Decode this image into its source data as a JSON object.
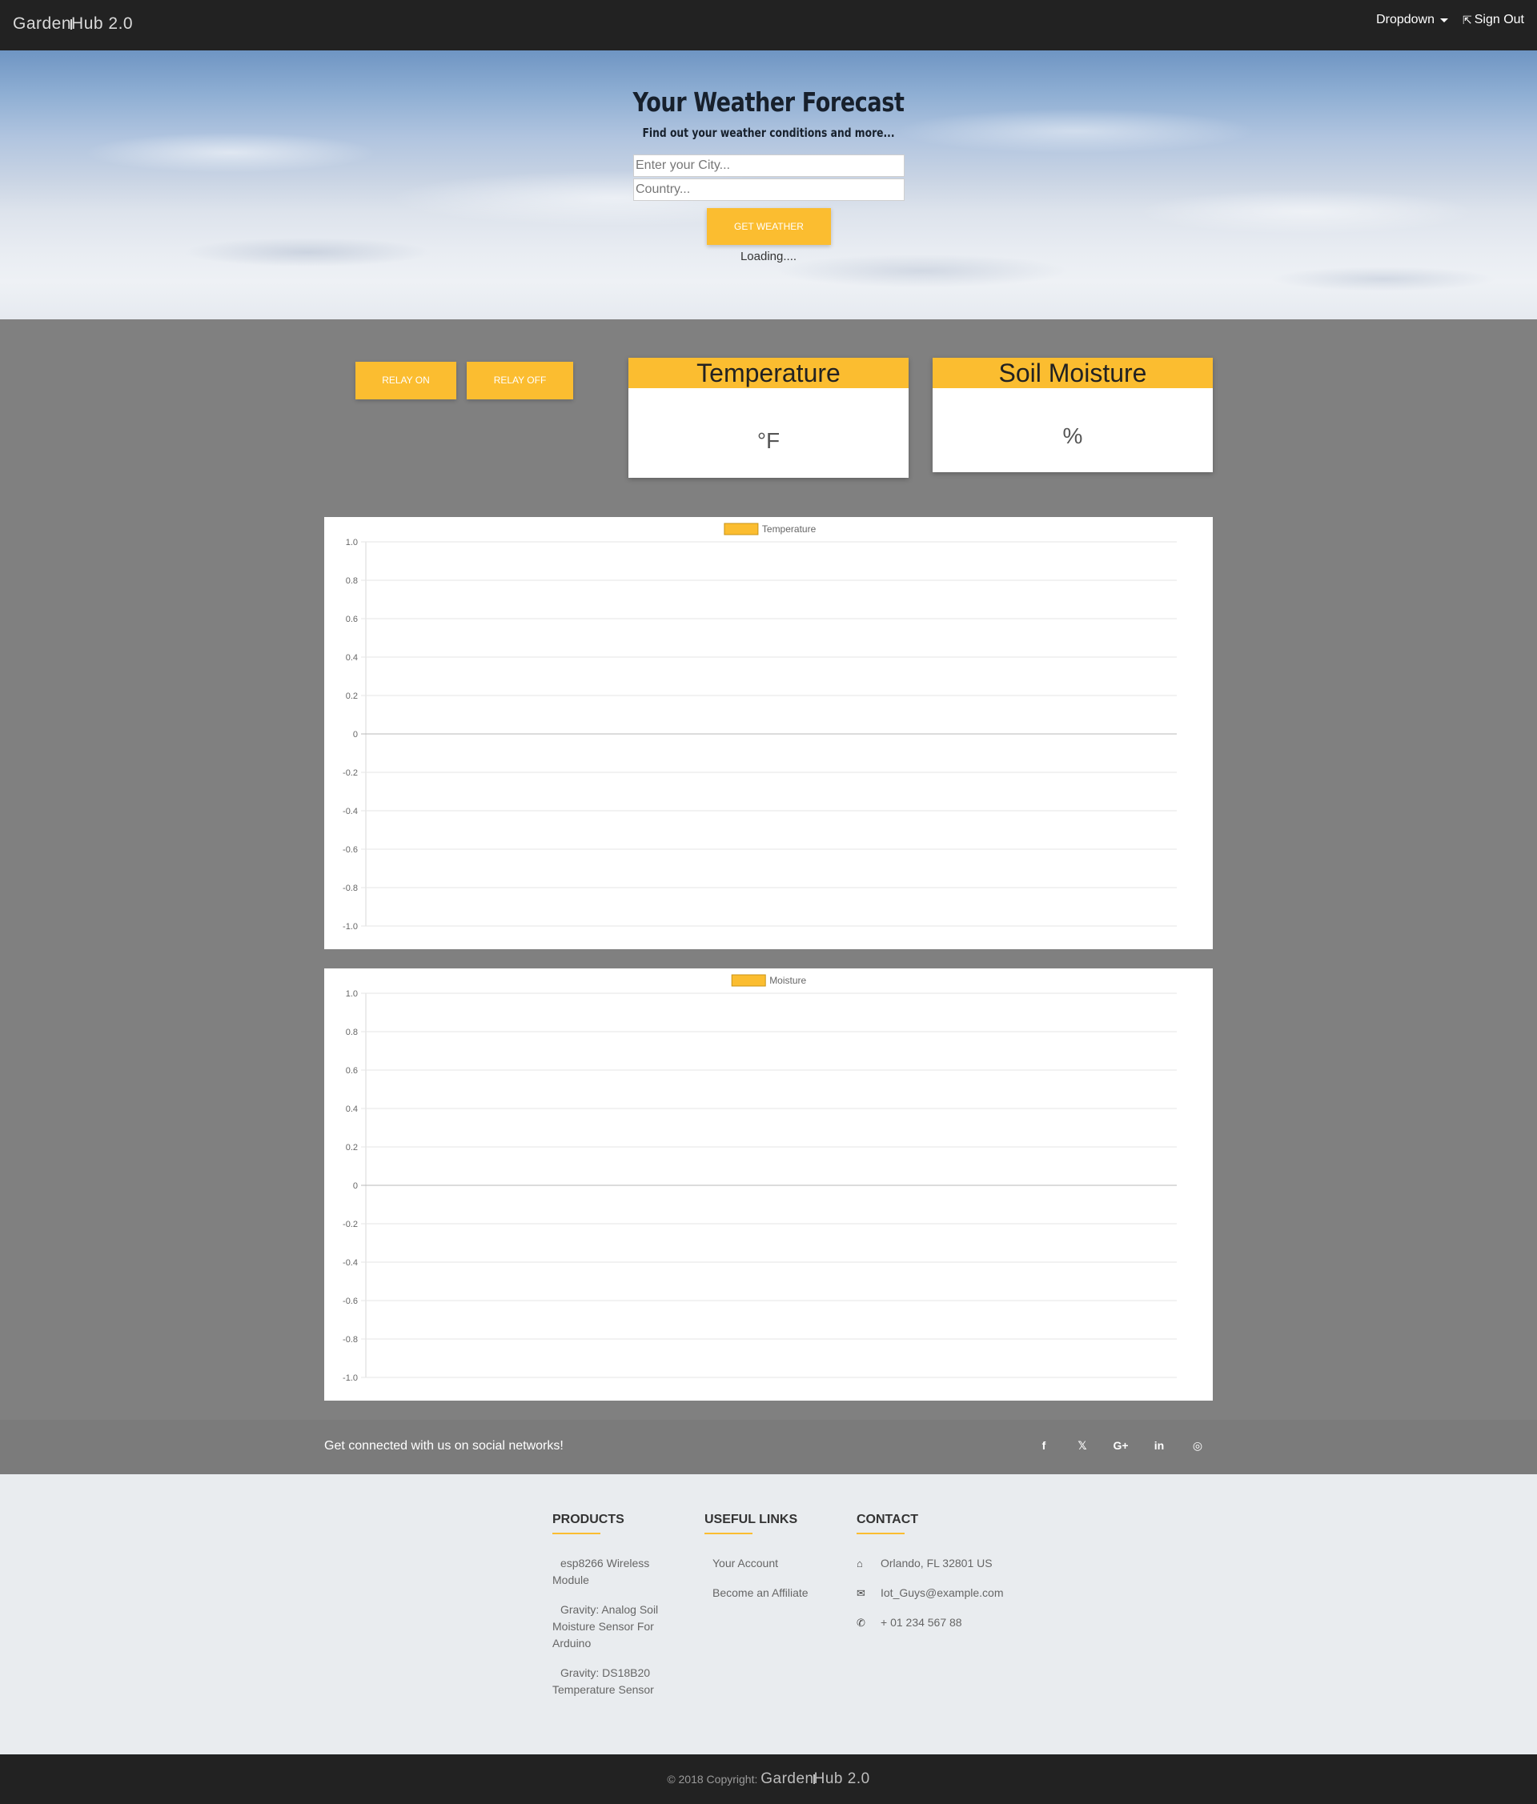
{
  "navbar": {
    "brand_part1": "Garden",
    "brand_part2": "Hub 2.0",
    "dropdown_label": "Dropdown",
    "signout_label": "Sign Out"
  },
  "hero": {
    "title": "Your Weather Forecast",
    "subtitle": "Find out your weather conditions and more...",
    "city_placeholder": "Enter your City...",
    "country_placeholder": "Country...",
    "button_label": "GET WEATHER",
    "status_text": "Loading...."
  },
  "controls": {
    "relay_on_label": "RELAY ON",
    "relay_off_label": "RELAY OFF"
  },
  "cards": {
    "temperature": {
      "title": "Temperature",
      "unit": "°F"
    },
    "soil": {
      "title": "Soil Moisture",
      "unit": "%"
    }
  },
  "colors": {
    "accent": "#fbbd30",
    "navbar_bg": "#222222",
    "page_bg": "#808080",
    "footer_bg": "#e9ecef"
  },
  "chart_data": [
    {
      "type": "line",
      "series": [
        {
          "name": "Temperature",
          "values": []
        }
      ],
      "x": [],
      "ylim": [
        -1.0,
        1.0
      ],
      "yticks": [
        "1.0",
        "0.8",
        "0.6",
        "0.4",
        "0.2",
        "0",
        "-0.2",
        "-0.4",
        "-0.6",
        "-0.8",
        "-1.0"
      ],
      "legend": "top-center",
      "grid": true,
      "color": "#fbbd30"
    },
    {
      "type": "line",
      "series": [
        {
          "name": "Moisture",
          "values": []
        }
      ],
      "x": [],
      "ylim": [
        -1.0,
        1.0
      ],
      "yticks": [
        "1.0",
        "0.8",
        "0.6",
        "0.4",
        "0.2",
        "0",
        "-0.2",
        "-0.4",
        "-0.6",
        "-0.8",
        "-1.0"
      ],
      "legend": "top-center",
      "grid": true,
      "color": "#fbbd30"
    }
  ],
  "social": {
    "text": "Get connected with us on social networks!",
    "icons": [
      {
        "name": "facebook-icon",
        "glyph": "f"
      },
      {
        "name": "twitter-icon",
        "glyph": "🐦"
      },
      {
        "name": "google-plus-icon",
        "glyph": "G+"
      },
      {
        "name": "linkedin-icon",
        "glyph": "in"
      },
      {
        "name": "instagram-icon",
        "glyph": "◎"
      }
    ]
  },
  "footer": {
    "products": {
      "heading": "PRODUCTS",
      "items": [
        "esp8266 Wireless Module",
        "Gravity: Analog Soil Moisture Sensor For Arduino",
        "Gravity: DS18B20 Temperature Sensor"
      ]
    },
    "links": {
      "heading": "USEFUL LINKS",
      "items": [
        "Your Account",
        "Become an Affiliate"
      ]
    },
    "contact": {
      "heading": "CONTACT",
      "address": "Orlando, FL 32801 US",
      "email": "Iot_Guys@example.com",
      "phone": "+ 01 234 567 88"
    }
  },
  "bottom": {
    "copyright": "© 2018 Copyright:",
    "brand_part1": "Garden",
    "brand_part2": "Hub 2.0"
  }
}
